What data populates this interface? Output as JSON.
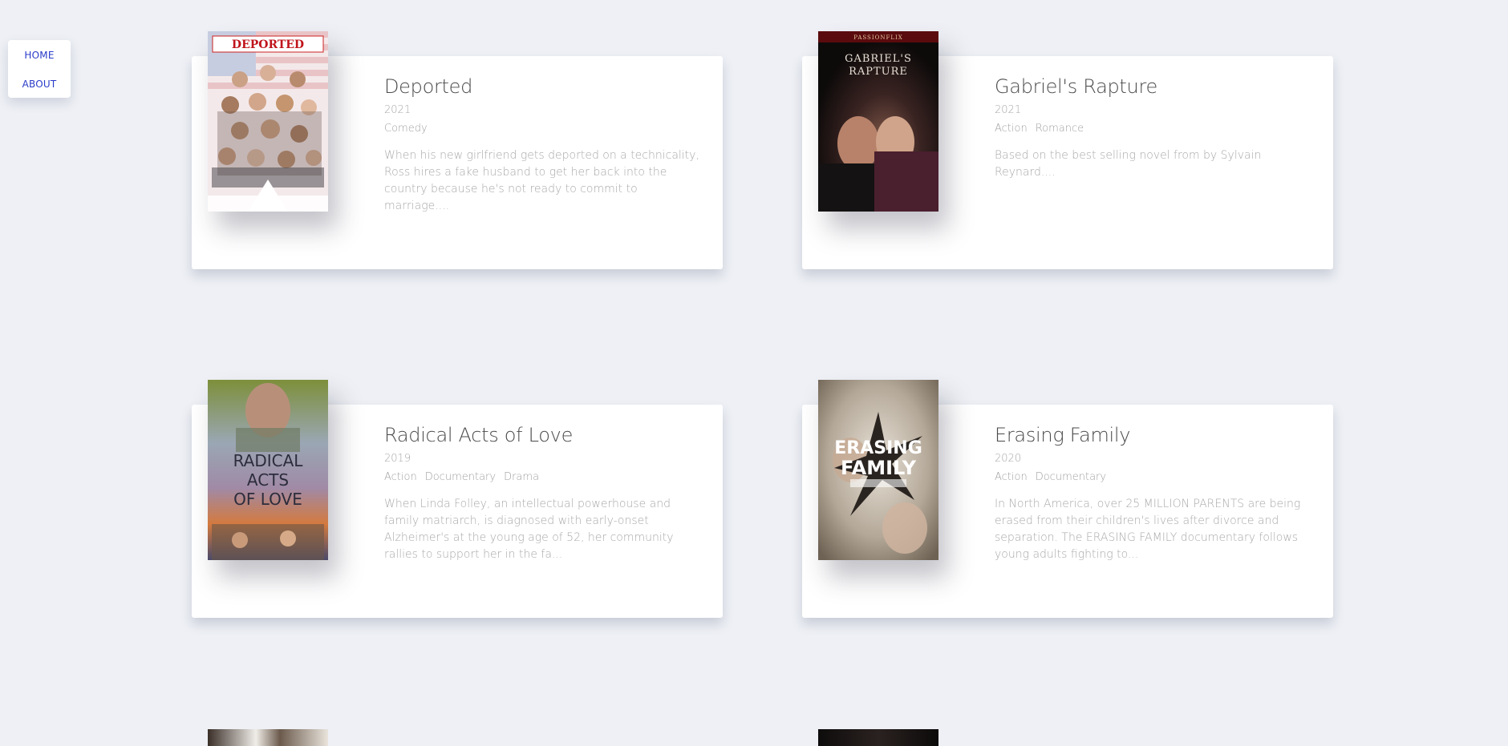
{
  "nav": {
    "home_label": "HOME",
    "about_label": "ABOUT"
  },
  "movies": [
    {
      "title": "Deported",
      "year": "2021",
      "genres": [
        "Comedy"
      ],
      "description": "When his new girlfriend gets deported on a technicality, Ross hires a fake husband to get her back into the country because he's not ready to commit to marriage....",
      "poster_text": "DEPORTED"
    },
    {
      "title": "Gabriel's Rapture",
      "year": "2021",
      "genres": [
        "Action",
        "Romance"
      ],
      "description": "Based on the best selling novel from by Sylvain Reynard....",
      "poster_text": "GABRIEL'S RAPTURE",
      "poster_brand": "PASSIONFLIX"
    },
    {
      "title": "Radical Acts of Love",
      "year": "2019",
      "genres": [
        "Action",
        "Documentary",
        "Drama"
      ],
      "description": "When Linda Folley, an intellectual powerhouse and family matriarch, is diagnosed with early-onset Alzheimer's at the young age of 52, her community rallies to support her in the fa...",
      "poster_text": "RADICAL ACTS OF LOVE"
    },
    {
      "title": "Erasing Family",
      "year": "2020",
      "genres": [
        "Action",
        "Documentary"
      ],
      "description": "In North America, over 25 MILLION PARENTS are being erased from their children's lives after divorce and separation. The ERASING FAMILY documentary follows young adults fighting to...",
      "poster_text": "ERASING FAMILY"
    }
  ],
  "colors": {
    "background": "#eef0f5",
    "nav_link": "#2a3bc9",
    "title": "#4a4a4a",
    "muted": "#a9a9a9"
  }
}
